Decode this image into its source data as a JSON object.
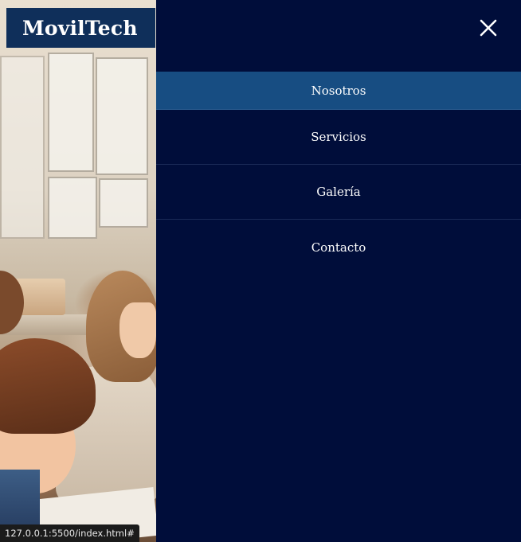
{
  "brand": {
    "name": "MovilTech"
  },
  "drawer": {
    "close_icon": "close-icon",
    "items": [
      {
        "label": "Nosotros",
        "active": true
      },
      {
        "label": "Servicios",
        "active": false
      },
      {
        "label": "Galería",
        "active": false
      },
      {
        "label": "Contacto",
        "active": false
      }
    ]
  },
  "status_bar": {
    "url": "127.0.0.1:5500/index.html#"
  },
  "colors": {
    "drawer_bg": "#000d3a",
    "active_item": "#174d82",
    "brand_bg": "#0f2f5a",
    "text": "#ffffff"
  }
}
